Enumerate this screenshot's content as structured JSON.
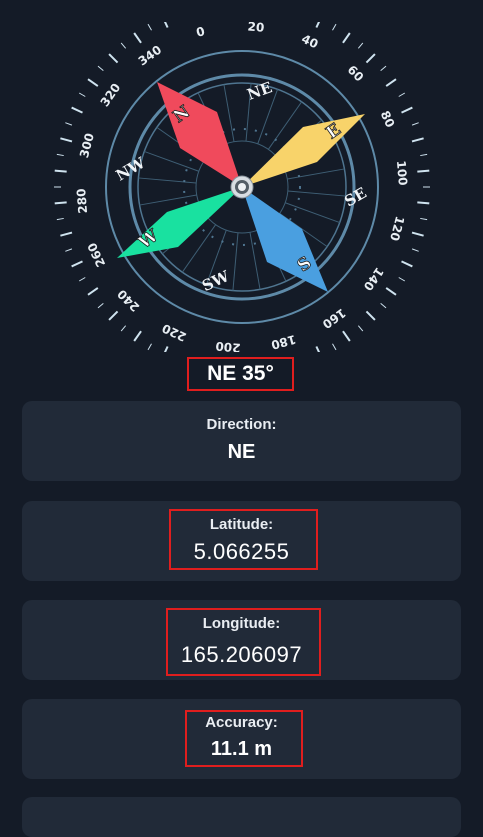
{
  "compass": {
    "cardinals": {
      "n": "N",
      "e": "E",
      "s": "S",
      "w": "W"
    },
    "intercardinals": {
      "ne": "NE",
      "se": "SE",
      "sw": "SW",
      "nw": "NW"
    },
    "degree_labels": [
      "0",
      "20",
      "40",
      "60",
      "80",
      "100",
      "120",
      "140",
      "160",
      "180",
      "200",
      "220",
      "240",
      "260",
      "280",
      "300",
      "320",
      "340"
    ],
    "colors": {
      "north": "#f04a5c",
      "east": "#f8d36a",
      "south": "#4a9fe0",
      "west": "#19e1a0",
      "ring": "#5e8aa8",
      "tick": "#cfe3ef"
    }
  },
  "heading": "NE 35°",
  "cards": {
    "direction": {
      "label": "Direction:",
      "value": "NE"
    },
    "latitude": {
      "label": "Latitude:",
      "value": "5.066255"
    },
    "longitude": {
      "label": "Longitude:",
      "value": "165.206097"
    },
    "accuracy": {
      "label": "Accuracy:",
      "value": "11.1 m"
    }
  }
}
